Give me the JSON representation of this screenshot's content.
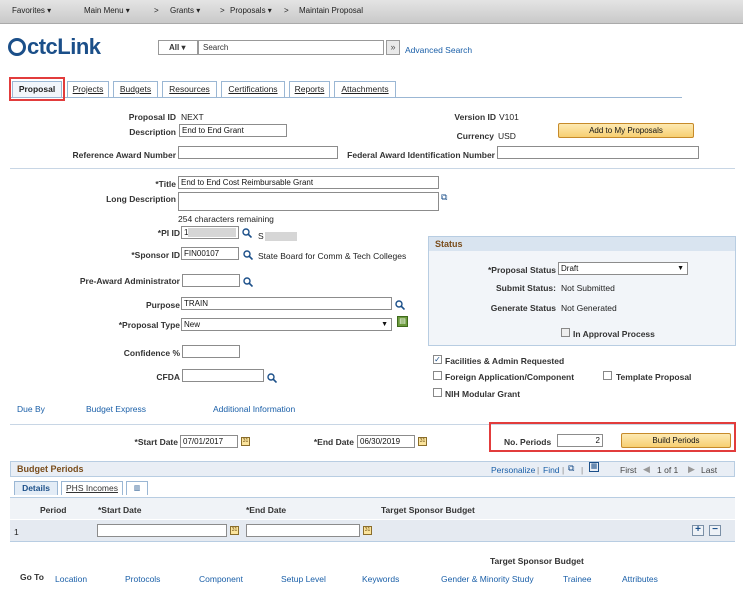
{
  "topnav": {
    "favorites": "Favorites ▾",
    "main_menu": "Main Menu ▾",
    "crumb1": "Grants ▾",
    "crumb2": "Proposals ▾",
    "crumb3": "Maintain Proposal",
    "sep": ">"
  },
  "header": {
    "logo": "ctcLink",
    "search_scope": "All ▾",
    "search_placeholder": "Search",
    "advanced_search": "Advanced Search"
  },
  "tabs": [
    "Proposal",
    "Projects",
    "Budgets",
    "Resources",
    "Certifications",
    "Reports",
    "Attachments"
  ],
  "proposal": {
    "proposal_id_label": "Proposal ID",
    "proposal_id": "NEXT",
    "description_label": "Description",
    "description": "End to End Grant",
    "reference_award_label": "Reference Award Number",
    "reference_award": "",
    "version_id_label": "Version ID",
    "version_id": "V101",
    "currency_label": "Currency",
    "currency": "USD",
    "add_button": "Add to My Proposals",
    "federal_award_label": "Federal Award Identification Number",
    "federal_award": ""
  },
  "details": {
    "title_label": "*Title",
    "title": "End to End Cost Reimbursable Grant",
    "long_desc_label": "Long Description",
    "chars_remaining": "254 characters remaining",
    "pi_id_label": "*PI ID",
    "pi_id": "1",
    "pi_name": "S",
    "sponsor_id_label": "*Sponsor ID",
    "sponsor_id": "FIN00107",
    "sponsor_name": "State Board for Comm & Tech Colleges",
    "pre_award_label": "Pre-Award Administrator",
    "purpose_label": "Purpose",
    "purpose": "TRAIN",
    "proposal_type_label": "*Proposal Type",
    "proposal_type": "New",
    "confidence_label": "Confidence %",
    "cfda_label": "CFDA"
  },
  "status": {
    "header": "Status",
    "proposal_status_label": "*Proposal Status",
    "proposal_status": "Draft",
    "submit_status_label": "Submit Status:",
    "submit_status": "Not Submitted",
    "generate_status_label": "Generate Status",
    "generate_status": "Not Generated",
    "in_approval": "In Approval Process"
  },
  "checks": {
    "facilities": "Facilities & Admin Requested",
    "foreign": "Foreign Application/Component",
    "template": "Template Proposal",
    "nih": "NIH Modular Grant"
  },
  "links": {
    "due_by": "Due By",
    "budget_express": "Budget Express",
    "additional_info": "Additional Information"
  },
  "dates": {
    "start_label": "*Start Date",
    "start": "07/01/2017",
    "end_label": "*End Date",
    "end": "06/30/2019",
    "periods_label": "No. Periods",
    "periods": "2",
    "build_button": "Build Periods"
  },
  "budget_periods": {
    "header": "Budget Periods",
    "personalize": "Personalize",
    "find": "Find",
    "nav_text": "First",
    "range": "1 of 1",
    "last": "Last",
    "tab_details": "Details",
    "tab_phs": "PHS Incomes",
    "col_period": "Period",
    "col_start": "*Start Date",
    "col_end": "*End Date",
    "col_target": "Target Sponsor Budget",
    "row_period": "1"
  },
  "footer": {
    "target_sponsor_budget": "Target Sponsor Budget",
    "goto_label": "Go To",
    "links": [
      "Location",
      "Protocols",
      "Component",
      "Setup Level",
      "Keywords",
      "Gender & Minority Study",
      "Trainee",
      "Attributes"
    ]
  }
}
